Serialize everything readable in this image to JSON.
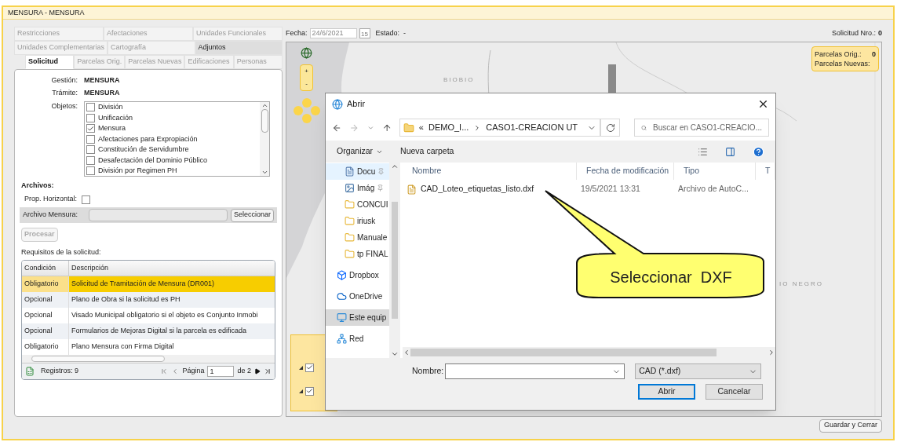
{
  "window": {
    "title": "MENSURA  -  MENSURA"
  },
  "tab_rows": [
    [
      {
        "label": "Restricciones",
        "selected": false,
        "disabled": true
      },
      {
        "label": "Afectaciones",
        "selected": false,
        "disabled": true
      },
      {
        "label": "Unidades Funcionales",
        "selected": false,
        "disabled": true
      }
    ],
    [
      {
        "label": "Unidades Complementarias",
        "selected": false,
        "disabled": true
      },
      {
        "label": "Cartografía",
        "selected": false,
        "disabled": true
      },
      {
        "label": "Adjuntos",
        "selected": false,
        "disabled": false
      }
    ],
    [
      {
        "label": "Solicitud",
        "selected": true,
        "disabled": false
      },
      {
        "label": "Parcelas Orig.",
        "selected": false,
        "disabled": true
      },
      {
        "label": "Parcelas Nuevas",
        "selected": false,
        "disabled": true
      },
      {
        "label": "Edificaciones",
        "selected": false,
        "disabled": true
      },
      {
        "label": "Personas",
        "selected": false,
        "disabled": true
      }
    ]
  ],
  "solicitud": {
    "fields": [
      {
        "label": "Gestión:",
        "value": "MENSURA"
      },
      {
        "label": "Trámite:",
        "value": "MENSURA"
      }
    ],
    "objetos_label": "Objetos:",
    "objetos": [
      {
        "label": "División",
        "checked": false
      },
      {
        "label": "Unificación",
        "checked": false
      },
      {
        "label": "Mensura",
        "checked": true
      },
      {
        "label": "Afectaciones para Expropiación",
        "checked": false
      },
      {
        "label": "Constitución de Servidumbre",
        "checked": false
      },
      {
        "label": "Desafectación del Dominio Público",
        "checked": false
      },
      {
        "label": "División por Regimen PH",
        "checked": false
      }
    ],
    "archivos_heading": "Archivos:",
    "prop_horizontal": {
      "label": "Prop. Horizontal:",
      "checked": false
    },
    "archivo_mensura": {
      "label": "Archivo Mensura:",
      "button": "Seleccionar"
    },
    "procesar": {
      "label": "Procesar",
      "disabled": true
    },
    "requisitos_label": "Requisitos de la solicitud:",
    "table": {
      "columns": [
        "Condición",
        "Descripción"
      ],
      "rows": [
        {
          "condicion": "Obligatorio",
          "descripcion": "Solicitud de Tramitación de Mensura (DR001)",
          "selected": true
        },
        {
          "condicion": "Opcional",
          "descripcion": "Plano de Obra si la solicitud es PH",
          "selected": false
        },
        {
          "condicion": "Opcional",
          "descripcion": "Visado Municipal obligatorio si el objeto es Conjunto Inmobi",
          "selected": false
        },
        {
          "condicion": "Opcional",
          "descripcion": "Formularios de Mejoras Digital si la parcela es edificada",
          "selected": false
        },
        {
          "condicion": "Obligatorio",
          "descripcion": "Plano Mensura con Firma Digital",
          "selected": false
        }
      ],
      "pager": {
        "records": "Registros: 9",
        "page_label": "Página",
        "page": "1",
        "of": "de 2"
      }
    }
  },
  "header": {
    "fecha_label": "Fecha:",
    "fecha": "24/6/2021",
    "calendar_day": "15",
    "estado_label": "Estado:",
    "estado": "-",
    "solicitud_label": "Solicitud Nro.:",
    "solicitud": "0"
  },
  "map": {
    "zoom_in": "+",
    "zoom_out": "-",
    "labels": [
      "BIOBIO",
      "IO NEGRO"
    ],
    "parcelas": [
      {
        "label": "Parcelas Orig.:",
        "value": "0"
      },
      {
        "label": "Parcelas Nuevas:"
      }
    ],
    "layers": [
      {
        "checked": true
      },
      {
        "checked": true
      }
    ]
  },
  "dialog": {
    "title": "Abrir",
    "breadcrumb_prefix": "«",
    "breadcrumb": [
      "DEMO_I...",
      "CASO1-CREACION UT"
    ],
    "search_placeholder": "Buscar en CASO1-CREACIO...",
    "toolbar": {
      "organize": "Organizar",
      "new_folder": "Nueva carpeta"
    },
    "nav": [
      {
        "kind": "document",
        "label": "Docu",
        "pinned": true,
        "selected": false,
        "hover": true
      },
      {
        "kind": "image",
        "label": "Imág",
        "pinned": true,
        "selected": false,
        "hover": false
      },
      {
        "kind": "folder",
        "label": "CONCUI",
        "pinned": false,
        "selected": false,
        "hover": false
      },
      {
        "kind": "folder",
        "label": "iriusk",
        "pinned": false,
        "selected": false,
        "hover": false
      },
      {
        "kind": "folder",
        "label": "Manuale",
        "pinned": false,
        "selected": false,
        "hover": false
      },
      {
        "kind": "folder",
        "label": "tp FINAL",
        "pinned": false,
        "selected": false,
        "hover": false
      },
      {
        "kind": "dropbox",
        "label": "Dropbox",
        "pinned": false,
        "selected": false,
        "hover": false
      },
      {
        "kind": "cloud",
        "label": "OneDrive",
        "pinned": false,
        "selected": false,
        "hover": false
      },
      {
        "kind": "pc",
        "label": "Este equip",
        "pinned": false,
        "selected": true,
        "hover": false
      },
      {
        "kind": "network",
        "label": "Red",
        "pinned": false,
        "selected": false,
        "hover": false
      }
    ],
    "columns": [
      "Nombre",
      "Fecha de modificación",
      "Tipo",
      "T"
    ],
    "files": [
      {
        "name": "CAD_Loteo_etiquetas_listo.dxf",
        "date": "19/5/2021 13:31",
        "type": "Archivo de AutoC..."
      }
    ],
    "name_label": "Nombre:",
    "filter": "CAD (*.dxf)",
    "open": "Abrir",
    "cancel": "Cancelar"
  },
  "callout": {
    "text": "Seleccionar  DXF"
  },
  "footer": {
    "save_close": "Guardar y Cerrar"
  }
}
